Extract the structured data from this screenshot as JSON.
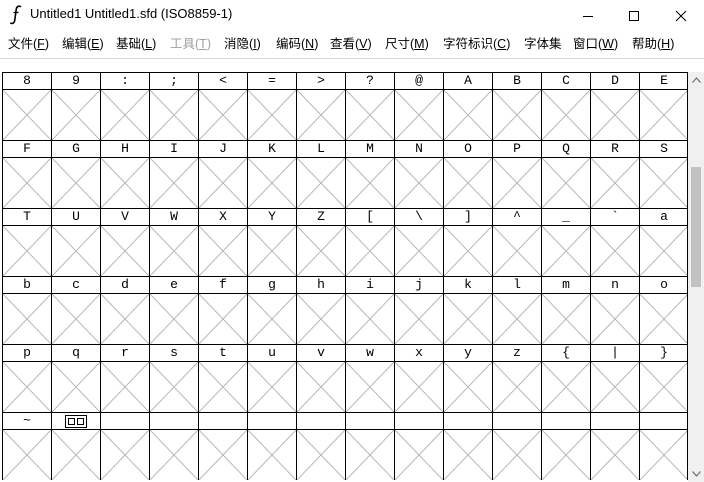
{
  "window": {
    "title": "Untitled1  Untitled1.sfd (ISO8859-1)"
  },
  "menu": [
    {
      "label": "文件(",
      "key": "F",
      "end": ")",
      "enabled": true
    },
    {
      "label": "编辑(",
      "key": "E",
      "end": ")",
      "enabled": true
    },
    {
      "label": "基础(",
      "key": "L",
      "end": ")",
      "enabled": true
    },
    {
      "label": "工具(",
      "key": "T",
      "end": ")",
      "enabled": false
    },
    {
      "label": "消隐(",
      "key": "I",
      "end": ")",
      "enabled": true
    },
    {
      "label": "编码(",
      "key": "N",
      "end": ")",
      "enabled": true
    },
    {
      "label": "查看(",
      "key": "V",
      "end": ")",
      "enabled": true
    },
    {
      "label": "尺寸(",
      "key": "M",
      "end": ")",
      "enabled": true
    },
    {
      "label": "字符标识(",
      "key": "C",
      "end": ")",
      "enabled": true
    },
    {
      "label": "字体集",
      "key": "",
      "end": "",
      "enabled": true
    },
    {
      "label": "窗口(",
      "key": "W",
      "end": ")",
      "enabled": true
    },
    {
      "label": "帮助(",
      "key": "H",
      "end": ")",
      "enabled": true
    }
  ],
  "icons": {
    "app": "fontforge-icon",
    "minimize": "minimize-icon",
    "maximize": "maximize-icon",
    "close": "close-icon",
    "scroll_up": "scroll-up-icon",
    "scroll_down": "scroll-down-icon"
  },
  "glyph_rows": [
    [
      "8",
      "9",
      ":",
      ";",
      "<",
      "=",
      ">",
      "?",
      "@",
      "A",
      "B",
      "C",
      "D",
      "E"
    ],
    [
      "F",
      "G",
      "H",
      "I",
      "J",
      "K",
      "L",
      "M",
      "N",
      "O",
      "P",
      "Q",
      "R",
      "S"
    ],
    [
      "T",
      "U",
      "V",
      "W",
      "X",
      "Y",
      "Z",
      "[",
      "\\",
      "]",
      "^",
      "_",
      "`",
      "a"
    ],
    [
      "b",
      "c",
      "d",
      "e",
      "f",
      "g",
      "h",
      "i",
      "j",
      "k",
      "l",
      "m",
      "n",
      "o"
    ],
    [
      "p",
      "q",
      "r",
      "s",
      "t",
      "u",
      "v",
      "w",
      "x",
      "y",
      "z",
      "{",
      "|",
      "}"
    ],
    [
      "~",
      "[missing]",
      "",
      "",
      "",
      "",
      "",
      "",
      "",
      "",
      "",
      "",
      "",
      ""
    ]
  ]
}
